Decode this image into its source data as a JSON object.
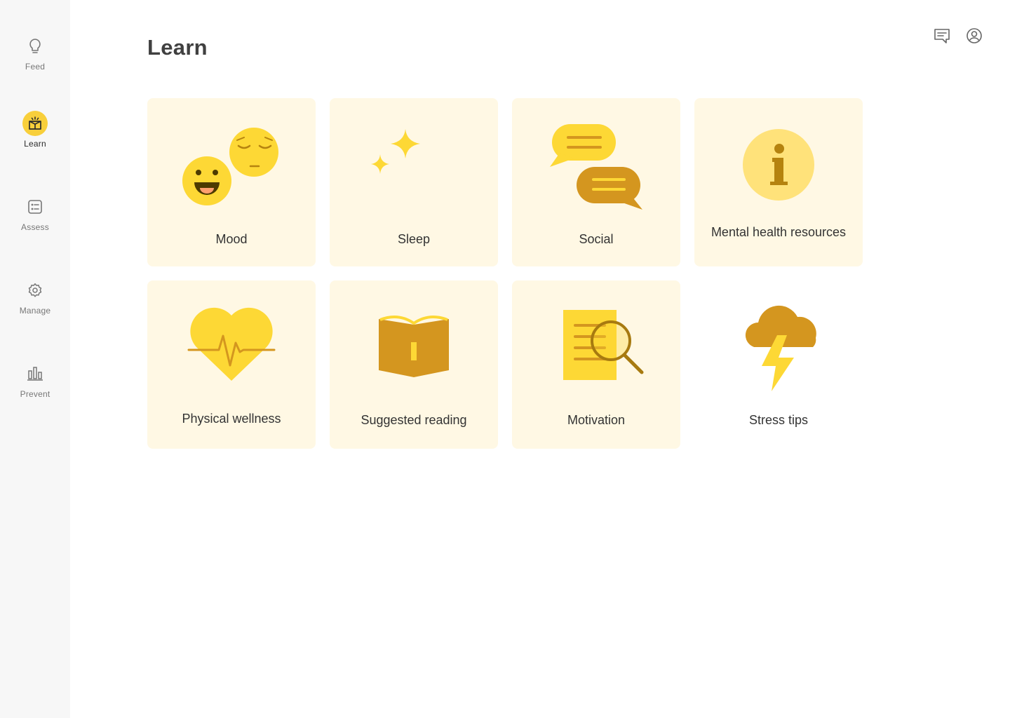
{
  "page_title": "Learn",
  "nav": {
    "feed": "Feed",
    "learn": "Learn",
    "assess": "Assess",
    "manage": "Manage",
    "prevent": "Prevent"
  },
  "header_icons": [
    "chat-icon",
    "profile-icon"
  ],
  "tiles": [
    {
      "label": "Mood",
      "icon": "mood-faces-icon"
    },
    {
      "label": "Sleep",
      "icon": "moon-stars-icon"
    },
    {
      "label": "Social",
      "icon": "speech-bubbles-icon"
    },
    {
      "label": "Mental health resources",
      "icon": "info-icon"
    },
    {
      "label": "Physical wellness",
      "icon": "heartbeat-icon"
    },
    {
      "label": "Suggested reading",
      "icon": "open-book-icon"
    },
    {
      "label": "Motivation",
      "icon": "document-search-icon"
    },
    {
      "label": "Stress tips",
      "icon": "storm-cloud-icon"
    }
  ],
  "colors": {
    "accent": "#f8cf3b",
    "tile_bg": "#fff8e4",
    "sidebar_bg": "#f7f7f7",
    "icon_light": "#fdd835",
    "icon_mid": "#f0be38",
    "icon_dark": "#d4961f"
  }
}
